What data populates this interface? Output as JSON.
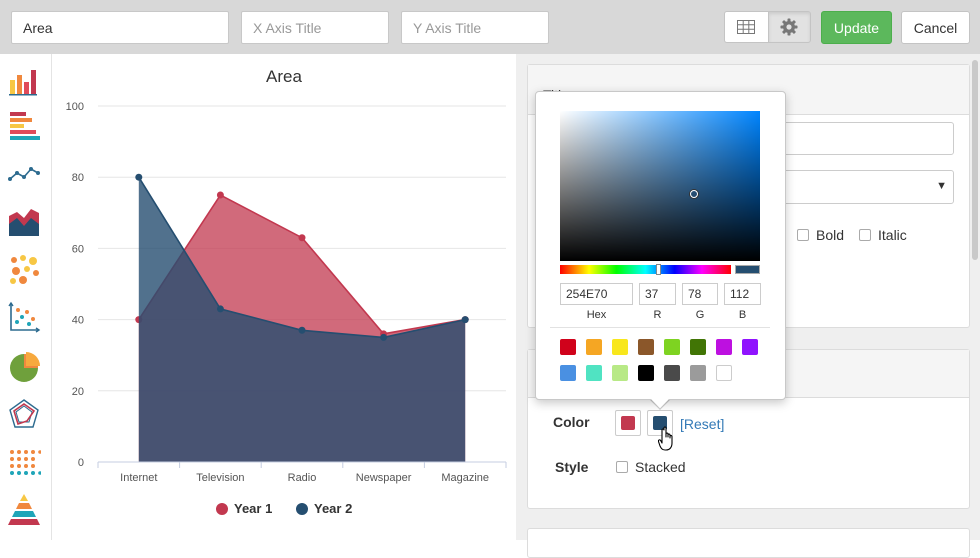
{
  "toolbar": {
    "chart_title_value": "Area",
    "x_axis_placeholder": "X Axis Title",
    "y_axis_placeholder": "Y Axis Title",
    "table_icon": "table-grid-icon",
    "settings_icon": "gear-icon",
    "update_label": "Update",
    "cancel_label": "Cancel"
  },
  "sidebar": {
    "items": [
      {
        "name": "bar-chart-icon"
      },
      {
        "name": "horizontal-bar-chart-icon"
      },
      {
        "name": "line-chart-icon"
      },
      {
        "name": "area-chart-icon"
      },
      {
        "name": "bubble-chart-icon"
      },
      {
        "name": "scatter-chart-icon"
      },
      {
        "name": "pie-chart-icon"
      },
      {
        "name": "radar-chart-icon"
      },
      {
        "name": "dot-matrix-icon"
      },
      {
        "name": "pyramid-chart-icon"
      }
    ]
  },
  "chart_data": {
    "type": "area",
    "title": "Area",
    "xlabel": "",
    "ylabel": "",
    "categories": [
      "Internet",
      "Television",
      "Radio",
      "Newspaper",
      "Magazine"
    ],
    "ylim": [
      0,
      100
    ],
    "yticks": [
      0,
      20,
      40,
      60,
      80,
      100
    ],
    "grid": true,
    "legend": "bottom",
    "series": [
      {
        "name": "Year 1",
        "values": [
          40,
          75,
          63,
          36,
          40
        ],
        "color": "#c2384f"
      },
      {
        "name": "Year 2",
        "values": [
          80,
          43,
          37,
          35,
          40
        ],
        "color": "#254e70"
      }
    ]
  },
  "settings": {
    "title_section_label": "Title",
    "bold_label": "Bold",
    "italic_label": "Italic",
    "color_label": "Color",
    "reset_label": "[Reset]",
    "style_label": "Style",
    "stacked_label": "Stacked"
  },
  "color_picker": {
    "hex_value": "254E70",
    "r_value": "37",
    "g_value": "78",
    "b_value": "112",
    "hex_caption": "Hex",
    "r_caption": "R",
    "g_caption": "G",
    "b_caption": "B",
    "current_color": "#254e70",
    "palette": [
      "#d0021b",
      "#f5a623",
      "#f8e71c",
      "#8b572a",
      "#7ed321",
      "#417505",
      "#bd10e0",
      "#9013fe",
      "#4a90e2",
      "#50e3c2",
      "#b8e986",
      "#000000",
      "#4a4a4a",
      "#9b9b9b",
      "#ffffff"
    ]
  }
}
